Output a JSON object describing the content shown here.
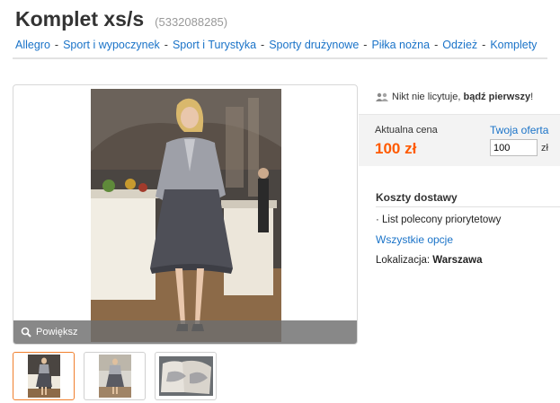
{
  "listing": {
    "title": "Komplet xs/s",
    "item_id": "(5332088285)"
  },
  "breadcrumb": [
    "Allegro",
    "Sport i wypoczynek",
    "Sport i Turystyka",
    "Sporty drużynowe",
    "Piłka nożna",
    "Odzież",
    "Komplety"
  ],
  "breadcrumb_separator": "-",
  "gallery": {
    "zoom_label": "Powiększ",
    "thumbnail_count": 3,
    "active_thumbnail": 1
  },
  "bidding": {
    "bidders_text": "Nikt nie licytuje,",
    "bidders_cta": "bądź pierwszy",
    "bidders_punct": "!"
  },
  "price": {
    "label": "Aktualna cena",
    "value": "100 zł",
    "offer_label": "Twoja oferta",
    "offer_value": "100",
    "offer_currency": "zł"
  },
  "shipping": {
    "heading": "Koszty dostawy",
    "items": [
      "List polecony priorytetowy"
    ],
    "all_options_label": "Wszystkie opcje"
  },
  "location": {
    "label": "Lokalizacja:",
    "value": "Warszawa"
  },
  "colors": {
    "link": "#1a73c8",
    "price": "#ff5a00",
    "active_thumb_border": "#f07f2d"
  },
  "icons": [
    "users-icon",
    "magnifier-icon"
  ]
}
